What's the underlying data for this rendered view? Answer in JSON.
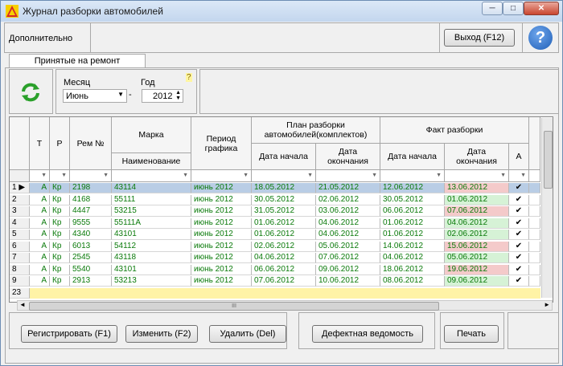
{
  "window": {
    "title": "Журнал разборки автомобилей",
    "minimize_glyph": "─",
    "maximize_glyph": "□",
    "close_glyph": "✕"
  },
  "toolbar": {
    "extra_label": "Дополнительно",
    "exit_label": "Выход (F12)",
    "help_glyph": "?"
  },
  "tab": {
    "label": "Принятые на ремонт автомобили"
  },
  "filter": {
    "month_label": "Месяц",
    "month_value": "Июнь",
    "year_label": "Год",
    "year_value": "2012",
    "dash": "-",
    "hint_glyph": "?",
    "refresh_icon": "refresh-icon"
  },
  "grid": {
    "headers": {
      "t": "Т",
      "p": "Р",
      "rem": "Рем №",
      "marka": "Марка",
      "naim": "Наименование",
      "period": "Период графика",
      "plan": "План разборки автомобилей(комплектов)",
      "plan_start": "Дата начала",
      "plan_end": "Дата окончания",
      "fact": "Факт разборки",
      "fact_start": "Дата начала",
      "fact_end": "Дата окончания",
      "a": "А"
    },
    "rows": [
      {
        "n": "1",
        "t": "А",
        "p": "Кр",
        "rem": "2198",
        "marka": "43114",
        "period": "июнь  2012",
        "ps": "18.05.2012",
        "pe": "21.05.2012",
        "fs": "12.06.2012",
        "fe": "13.06.2012",
        "fe_color": "#f4caca",
        "check": "✔",
        "selected": true
      },
      {
        "n": "2",
        "t": "А",
        "p": "Кр",
        "rem": "4168",
        "marka": "55111",
        "period": "июнь  2012",
        "ps": "30.05.2012",
        "pe": "02.06.2012",
        "fs": "30.05.2012",
        "fe": "01.06.2012",
        "fe_color": "#d6f2d6",
        "check": "✔"
      },
      {
        "n": "3",
        "t": "А",
        "p": "Кр",
        "rem": "4447",
        "marka": "53215",
        "period": "июнь  2012",
        "ps": "31.05.2012",
        "pe": "03.06.2012",
        "fs": "06.06.2012",
        "fe": "07.06.2012",
        "fe_color": "#f4caca",
        "check": "✔"
      },
      {
        "n": "4",
        "t": "А",
        "p": "Кр",
        "rem": "9555",
        "marka": "55111А",
        "period": "июнь  2012",
        "ps": "01.06.2012",
        "pe": "04.06.2012",
        "fs": "01.06.2012",
        "fe": "04.06.2012",
        "fe_color": "#d6f2d6",
        "check": "✔"
      },
      {
        "n": "5",
        "t": "А",
        "p": "Кр",
        "rem": "4340",
        "marka": "43101",
        "period": "июнь  2012",
        "ps": "01.06.2012",
        "pe": "04.06.2012",
        "fs": "01.06.2012",
        "fe": "02.06.2012",
        "fe_color": "#d6f2d6",
        "check": "✔"
      },
      {
        "n": "6",
        "t": "А",
        "p": "Кр",
        "rem": "6013",
        "marka": "54112",
        "period": "июнь  2012",
        "ps": "02.06.2012",
        "pe": "05.06.2012",
        "fs": "14.06.2012",
        "fe": "15.06.2012",
        "fe_color": "#f4caca",
        "check": "✔"
      },
      {
        "n": "7",
        "t": "А",
        "p": "Кр",
        "rem": "2545",
        "marka": "43118",
        "period": "июнь  2012",
        "ps": "04.06.2012",
        "pe": "07.06.2012",
        "fs": "04.06.2012",
        "fe": "05.06.2012",
        "fe_color": "#d6f2d6",
        "check": "✔"
      },
      {
        "n": "8",
        "t": "А",
        "p": "Кр",
        "rem": "5540",
        "marka": "43101",
        "period": "июнь  2012",
        "ps": "06.06.2012",
        "pe": "09.06.2012",
        "fs": "18.06.2012",
        "fe": "19.06.2012",
        "fe_color": "#f4caca",
        "check": "✔"
      },
      {
        "n": "9",
        "t": "А",
        "p": "Кр",
        "rem": "2913",
        "marka": "53213",
        "period": "июнь  2012",
        "ps": "07.06.2012",
        "pe": "10.06.2012",
        "fs": "08.06.2012",
        "fe": "09.06.2012",
        "fe_color": "#d6f2d6",
        "check": "✔"
      }
    ],
    "total_label": "23",
    "scroll_grip": "III"
  },
  "buttons": {
    "register": "Регистрировать (F1)",
    "edit": "Изменить (F2)",
    "delete": "Удалить (Del)",
    "defect": "Дефектная ведомость",
    "print": "Печать"
  },
  "colors": {
    "selected_row": "#b9cde5",
    "total_row": "#fff3a6",
    "help_blue": "#1f5fb7"
  }
}
